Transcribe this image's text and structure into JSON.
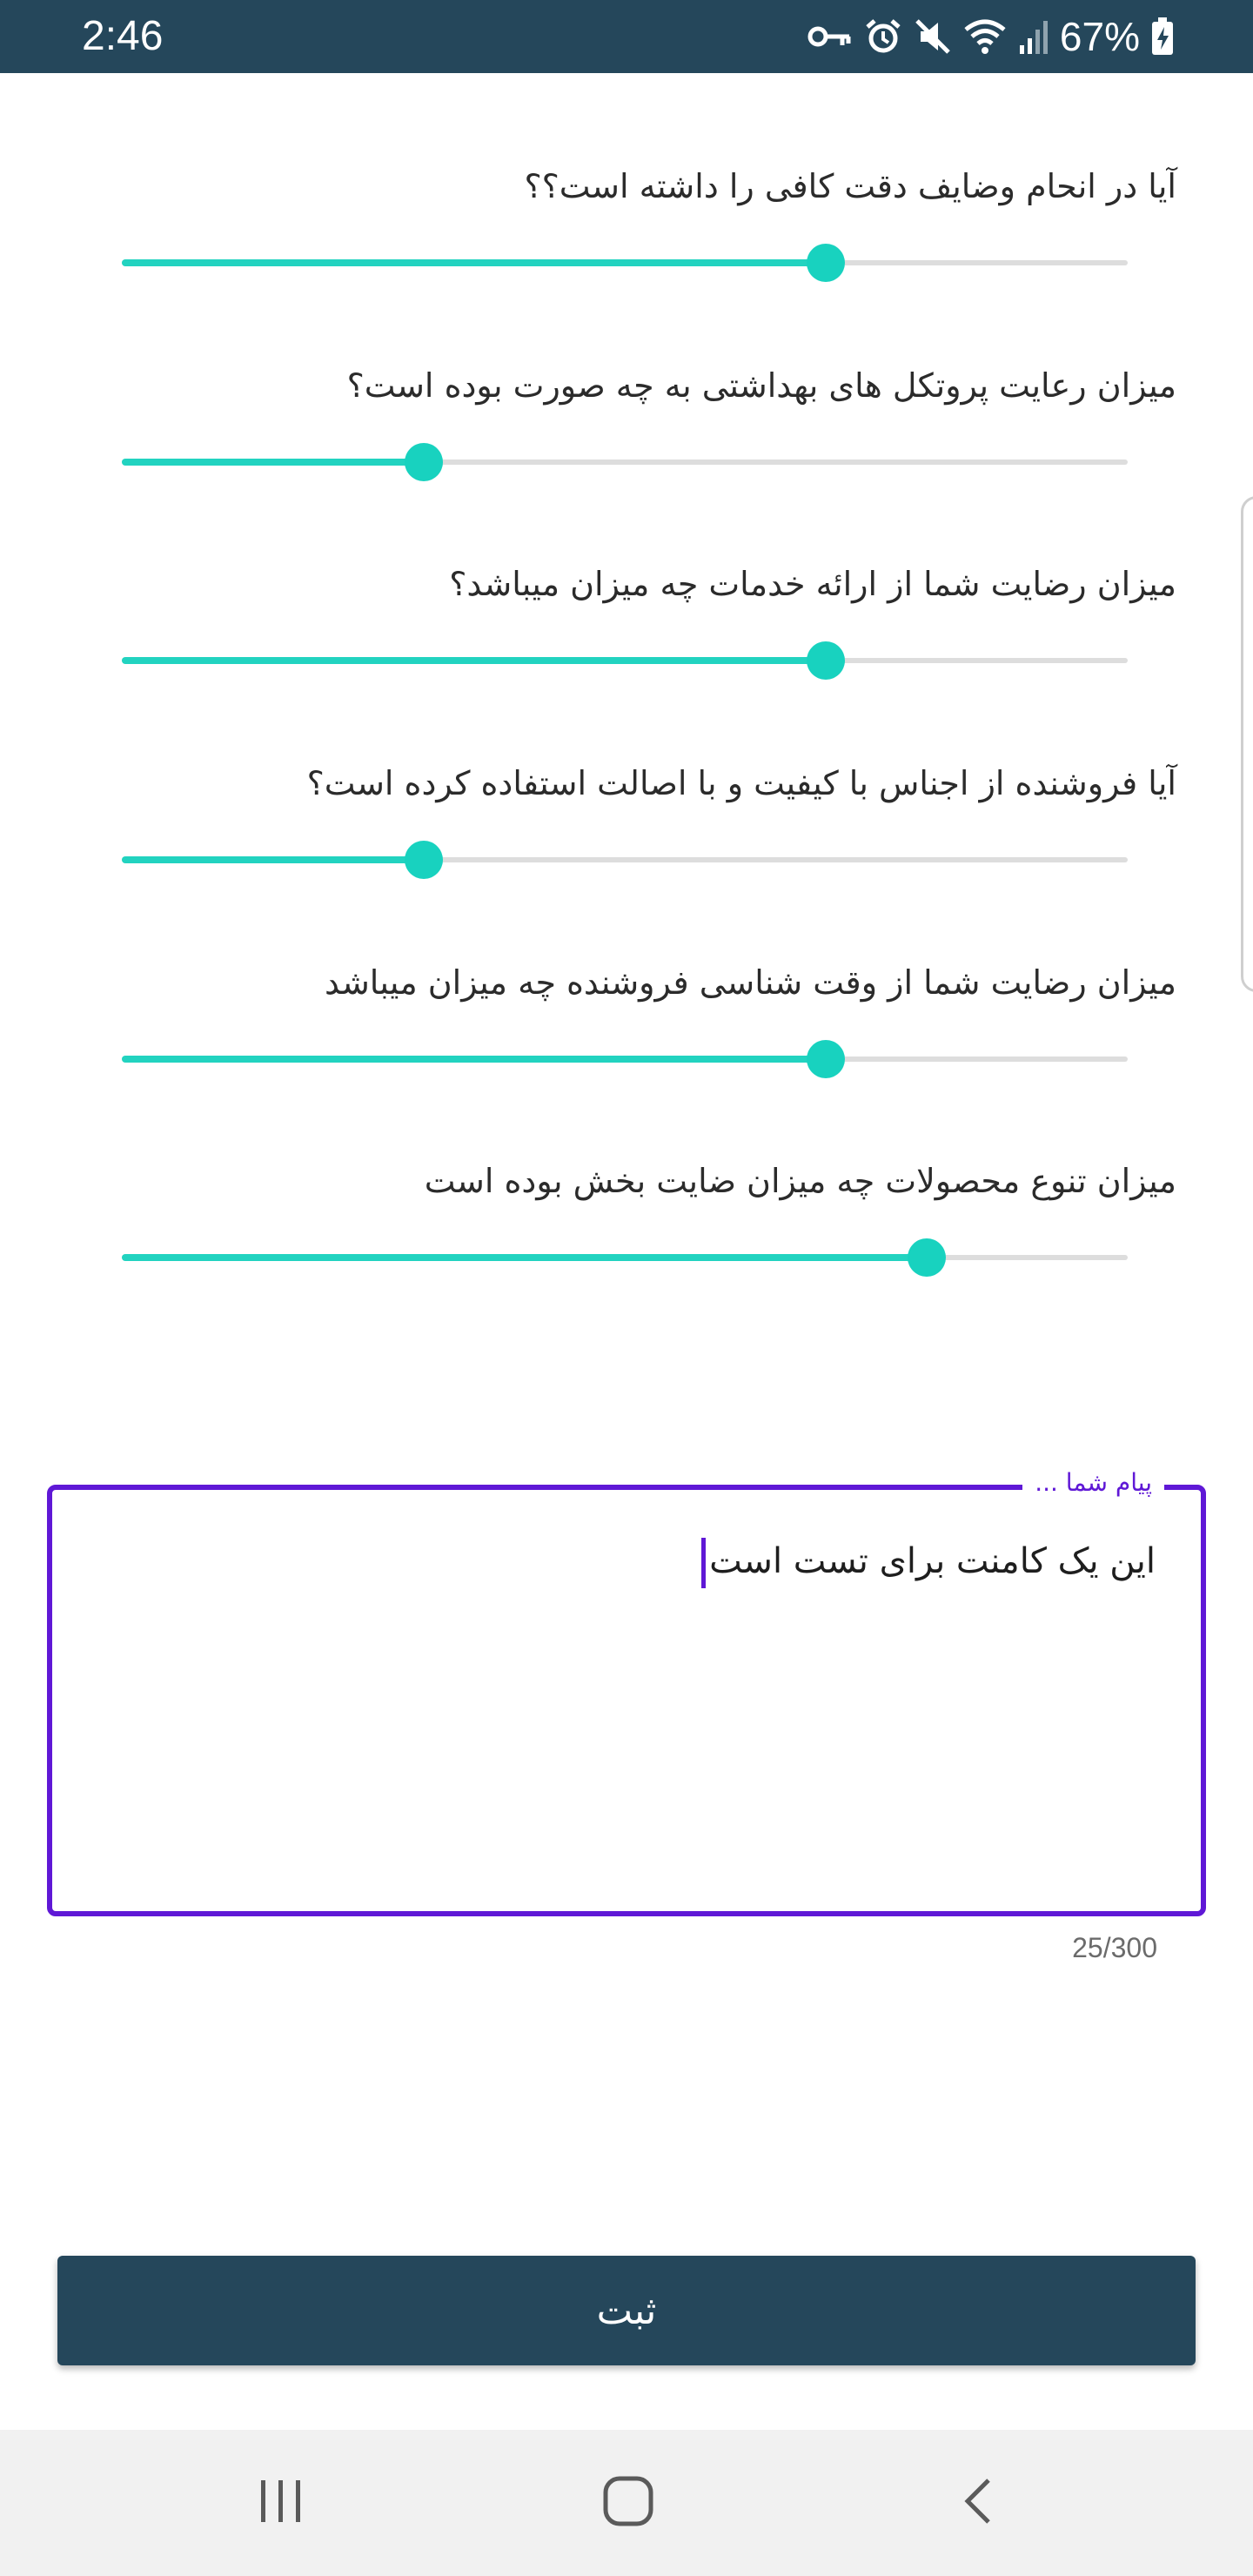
{
  "status_bar": {
    "time": "2:46",
    "battery_percent": "67%",
    "background_color": "#25475b",
    "icons": [
      "vpn-key-icon",
      "alarm-icon",
      "mute-icon",
      "wifi-icon",
      "signal-icon",
      "battery-charging-icon"
    ]
  },
  "survey": {
    "accent_color": "#18d2bf",
    "questions": [
      {
        "label": "آیا در انحام وضایف دقت کافی را داشته است؟؟",
        "value": 0.7
      },
      {
        "label": "میزان رعایت پروتکل های بهداشتی به چه صورت بوده است؟",
        "value": 0.3
      },
      {
        "label": "میزان رضایت شما از ارائه خدمات چه میزان میباشد؟",
        "value": 0.7
      },
      {
        "label": "آیا فروشنده از اجناس با کیفیت و با اصالت استفاده کرده است؟",
        "value": 0.3
      },
      {
        "label": "میزان رضایت شما از وقت شناسی فروشنده چه میزان میباشد",
        "value": 0.7
      },
      {
        "label": "میزان تنوع محصولات چه میزان ضایت بخش بوده است",
        "value": 0.8
      }
    ]
  },
  "comment": {
    "legend": "پیام شما ...",
    "text": "این یک کامنت برای تست است",
    "counter": "25/300",
    "border_color": "#5f18d6"
  },
  "submit": {
    "label": "ثبت"
  },
  "nav_bar": {
    "icons": [
      "recent-apps-icon",
      "home-icon",
      "back-icon"
    ]
  }
}
